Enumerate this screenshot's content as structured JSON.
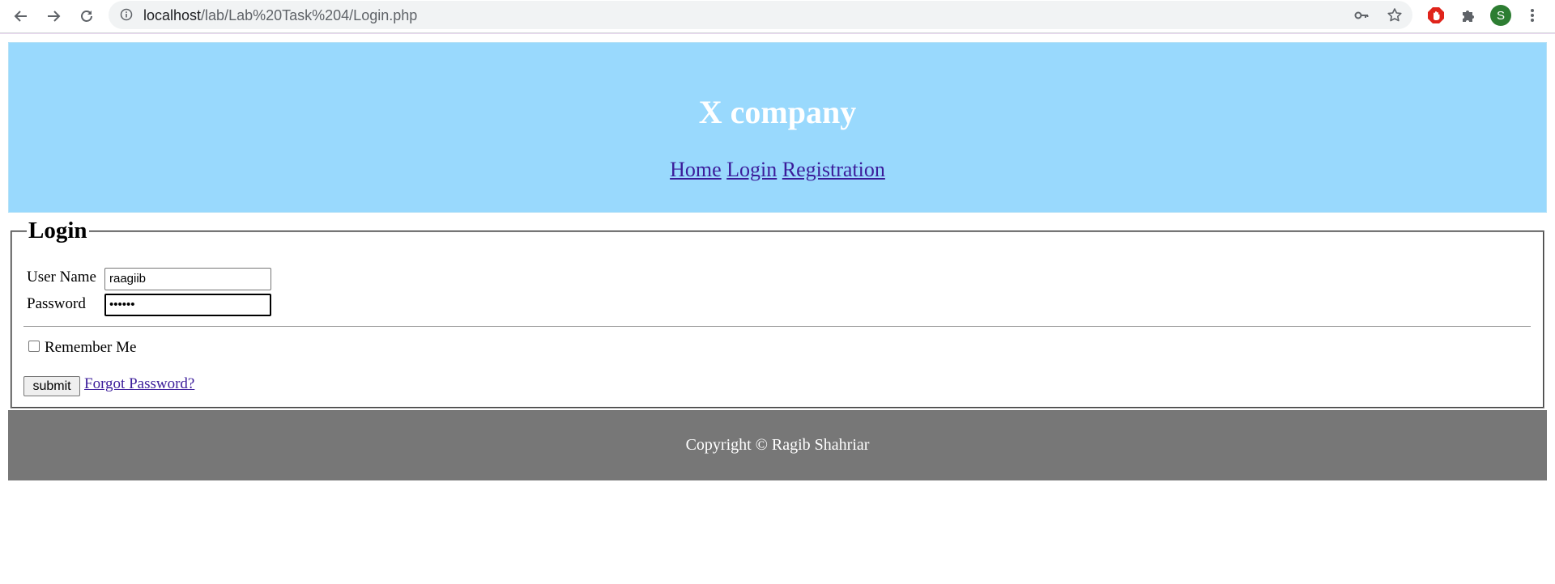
{
  "browser": {
    "url_host": "localhost",
    "url_path": "/lab/Lab%20Task%204/Login.php",
    "profile_initial": "S",
    "profile_color": "#2d7d32",
    "icons": [
      "back-arrow-icon",
      "forward-arrow-icon",
      "reload-icon",
      "info-icon",
      "key-icon",
      "star-icon",
      "adblock-icon",
      "extensions-puzzle-icon",
      "kebab-menu-icon"
    ]
  },
  "header": {
    "company": "X company",
    "nav": [
      "Home",
      "Login",
      "Registration"
    ],
    "background": "#99d9fd"
  },
  "login": {
    "legend": "Login",
    "username_label": "User Name",
    "username_value": "raagiib",
    "password_label": "Password",
    "password_value": "••••••",
    "remember_label": "Remember Me",
    "submit_label": "submit",
    "forgot_label": "Forgot Password?"
  },
  "footer": {
    "text": "Copyright © Ragib Shahriar",
    "background": "#777777"
  }
}
